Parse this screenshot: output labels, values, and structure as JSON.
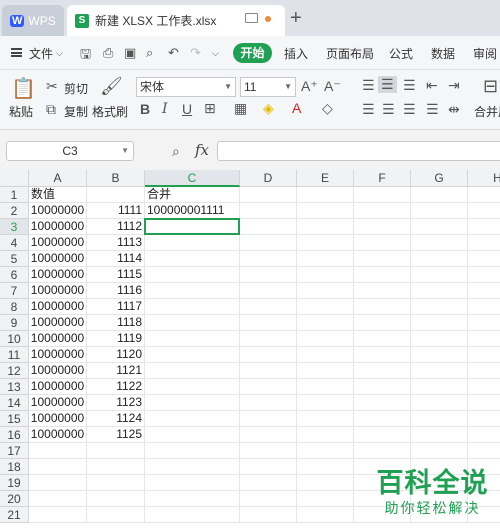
{
  "tabs": {
    "wps_label": "WPS",
    "doc_title": "新建 XLSX 工作表.xlsx",
    "new_tab": "+"
  },
  "menu": {
    "file": "文件",
    "start": "开始",
    "items": [
      "插入",
      "页面布局",
      "公式",
      "数据",
      "审阅"
    ]
  },
  "ribbon": {
    "paste": "粘贴",
    "cut": "剪切",
    "copy": "复制",
    "format_painter": "格式刷",
    "font_name": "宋体",
    "font_size": "11",
    "merge": "合并居"
  },
  "formula_bar": {
    "name_box": "C3",
    "fx": "fx",
    "value": ""
  },
  "sheet": {
    "columns": [
      "A",
      "B",
      "C",
      "D",
      "E",
      "F",
      "G",
      "H"
    ],
    "rows": [
      "1",
      "2",
      "3",
      "4",
      "5",
      "6",
      "7",
      "8",
      "9",
      "10",
      "11",
      "12",
      "13",
      "14",
      "15",
      "16",
      "17",
      "18",
      "19",
      "20",
      "21"
    ],
    "a_values": [
      "数值",
      "10000000",
      "10000000",
      "10000000",
      "10000000",
      "10000000",
      "10000000",
      "10000000",
      "10000000",
      "10000000",
      "10000000",
      "10000000",
      "10000000",
      "10000000",
      "10000000",
      "10000000"
    ],
    "b_values": [
      "",
      "1111",
      "1112",
      "1113",
      "1114",
      "1115",
      "1116",
      "1117",
      "1118",
      "1119",
      "1120",
      "1121",
      "1122",
      "1123",
      "1124",
      "1125"
    ],
    "c_values": [
      "合并",
      "100000001111"
    ],
    "active_cell": "C3",
    "accent": "#1fa052"
  },
  "watermark": {
    "title": "百科全说",
    "subtitle": "助你轻松解决"
  }
}
